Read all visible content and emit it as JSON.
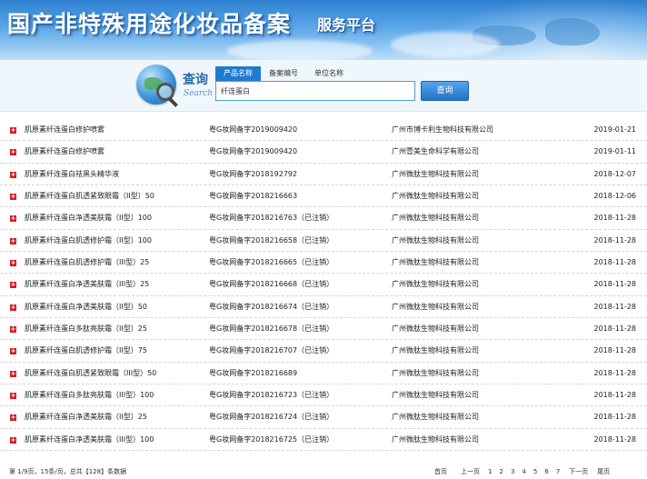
{
  "banner": {
    "title": "国产非特殊用途化妆品备案",
    "subtitle": "服务平台"
  },
  "search": {
    "logo_zh": "查询",
    "logo_en": "Search",
    "tabs": [
      "产品名称",
      "备案编号",
      "单位名称"
    ],
    "query": "纤连蛋白",
    "button": "查询"
  },
  "results": [
    {
      "name": "肌原素纤连蛋白修护喷雾",
      "no": "粤G妆网备字2019009420",
      "company": "广州市博卡利生物科技有限公司",
      "date": "2019-01-21"
    },
    {
      "name": "肌原素纤连蛋白修护喷雾",
      "no": "粤G妆网备字2019009420",
      "company": "广州壹美生命科学有限公司",
      "date": "2019-01-11"
    },
    {
      "name": "肌原素纤连蛋白祛黑头精华液",
      "no": "粤G妆网备字2018192792",
      "company": "广州微肽生物科技有限公司",
      "date": "2018-12-07"
    },
    {
      "name": "肌原素纤连蛋白肌透紧致眼霜（II型）50",
      "no": "粤G妆网备字2018216663",
      "company": "广州微肽生物科技有限公司",
      "date": "2018-12-06"
    },
    {
      "name": "肌原素纤连蛋白净透美肤霜（II型）100",
      "no": "粤G妆网备字2018216763（已注销）",
      "company": "广州微肽生物科技有限公司",
      "date": "2018-11-28"
    },
    {
      "name": "肌原素纤连蛋白肌透修护霜（II型）100",
      "no": "粤G妆网备字2018216658（已注销）",
      "company": "广州微肽生物科技有限公司",
      "date": "2018-11-28"
    },
    {
      "name": "肌原素纤连蛋白肌透修护霜（III型）25",
      "no": "粤G妆网备字2018216665（已注销）",
      "company": "广州微肽生物科技有限公司",
      "date": "2018-11-28"
    },
    {
      "name": "肌原素纤连蛋白净透美肤霜（III型）25",
      "no": "粤G妆网备字2018216668（已注销）",
      "company": "广州微肽生物科技有限公司",
      "date": "2018-11-28"
    },
    {
      "name": "肌原素纤连蛋白净透美肤霜（II型）50",
      "no": "粤G妆网备字2018216674（已注销）",
      "company": "广州微肽生物科技有限公司",
      "date": "2018-11-28"
    },
    {
      "name": "肌原素纤连蛋白多肽亮肤霜（II型）25",
      "no": "粤G妆网备字2018216678（已注销）",
      "company": "广州微肽生物科技有限公司",
      "date": "2018-11-28"
    },
    {
      "name": "肌原素纤连蛋白肌透修护霜（II型）75",
      "no": "粤G妆网备字2018216707（已注销）",
      "company": "广州微肽生物科技有限公司",
      "date": "2018-11-28"
    },
    {
      "name": "肌原素纤连蛋白肌透紧致眼霜（III型）50",
      "no": "粤G妆网备字2018216689",
      "company": "广州微肽生物科技有限公司",
      "date": "2018-11-28"
    },
    {
      "name": "肌原素纤连蛋白多肽亮肤霜（III型）100",
      "no": "粤G妆网备字2018216723（已注销）",
      "company": "广州微肽生物科技有限公司",
      "date": "2018-11-28"
    },
    {
      "name": "肌原素纤连蛋白净透美肤霜（II型）25",
      "no": "粤G妆网备字2018216724（已注销）",
      "company": "广州微肽生物科技有限公司",
      "date": "2018-11-28"
    },
    {
      "name": "肌原素纤连蛋白净透美肤霜（III型）100",
      "no": "粤G妆网备字2018216725（已注销）",
      "company": "广州微肽生物科技有限公司",
      "date": "2018-11-28"
    }
  ],
  "footer": {
    "info": "第 1/9页，15条/页，总共【128】条数据",
    "first": "首页",
    "prev": "上一页",
    "pages": [
      "1",
      "2",
      "3",
      "4",
      "5",
      "6",
      "7"
    ],
    "next": "下一页",
    "last": "尾页"
  },
  "colors": {
    "accent": "#1f7bd0",
    "plus_icon": "#d42020"
  }
}
